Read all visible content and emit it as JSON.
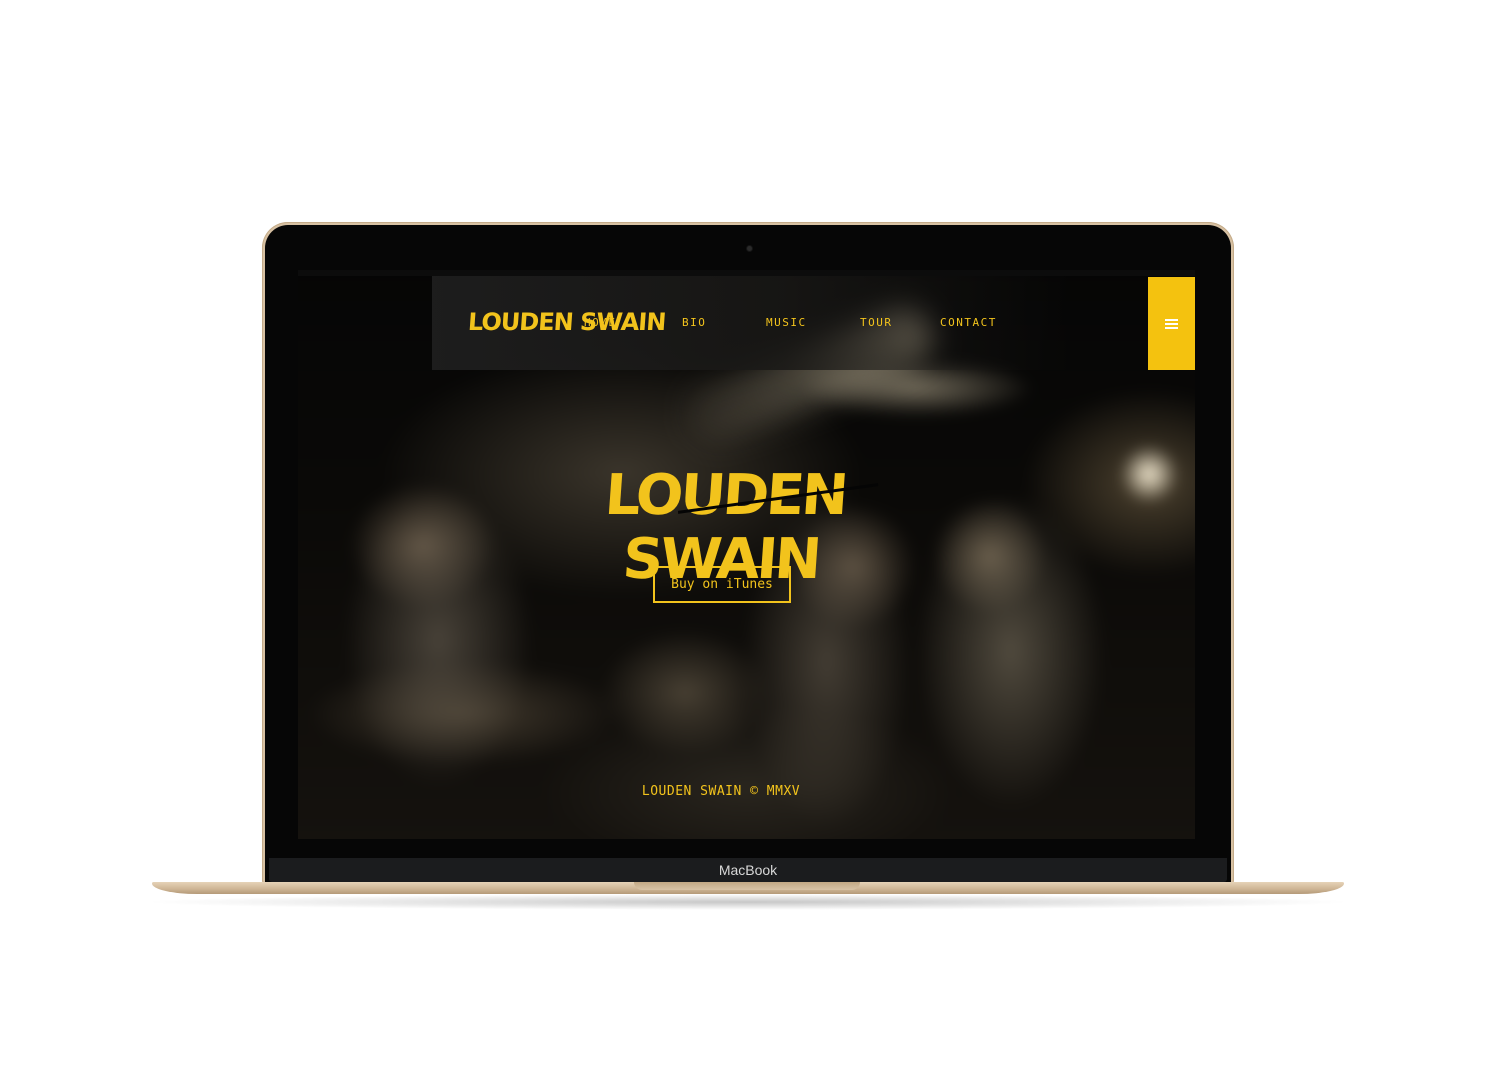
{
  "device": {
    "label": "MacBook"
  },
  "site": {
    "nav": {
      "logo": "LOUDEN SWAIN",
      "links": [
        "HOME",
        "BIO",
        "MUSIC",
        "TOUR",
        "CONTACT"
      ],
      "menu_icon": "hamburger-icon"
    },
    "hero": {
      "logo": "LOUDEN SWAIN",
      "cta_label": "Buy on iTunes"
    },
    "footer": {
      "copyright": "LOUDEN SWAIN © MMXV"
    }
  },
  "colors": {
    "accent": "#f2c31c",
    "menu_button": "#f4c20f",
    "background": "#050505",
    "device_gold": "#d7c1a3"
  }
}
